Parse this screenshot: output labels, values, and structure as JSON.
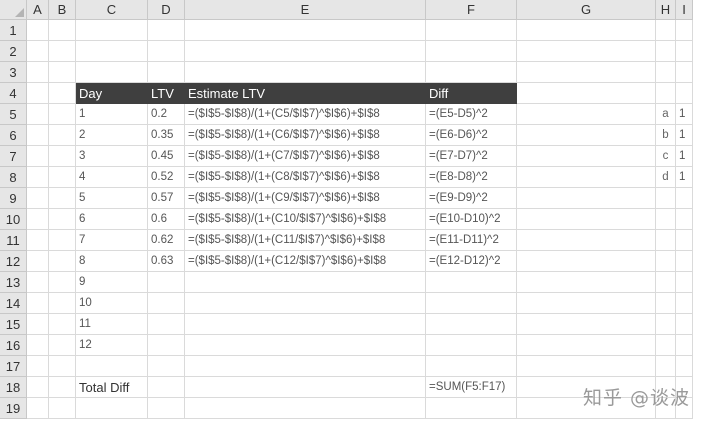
{
  "columns": [
    {
      "key": "A",
      "label": "A"
    },
    {
      "key": "B",
      "label": "B"
    },
    {
      "key": "C",
      "label": "C"
    },
    {
      "key": "D",
      "label": "D"
    },
    {
      "key": "E",
      "label": "E"
    },
    {
      "key": "F",
      "label": "F"
    },
    {
      "key": "G",
      "label": "G"
    },
    {
      "key": "H",
      "label": "H"
    },
    {
      "key": "I",
      "label": "I"
    }
  ],
  "rows": [
    "1",
    "2",
    "3",
    "4",
    "5",
    "6",
    "7",
    "8",
    "9",
    "10",
    "11",
    "12",
    "13",
    "14",
    "15",
    "16",
    "17",
    "18",
    "19"
  ],
  "header": {
    "day": "Day",
    "ltv": "LTV",
    "estimate": "Estimate LTV",
    "diff": "Diff"
  },
  "data_rows": [
    {
      "day": "1",
      "ltv": "0.2",
      "estimate": "=($I$5-$I$8)/(1+(C5/$I$7)^$I$6)+$I$8",
      "diff": "=(E5-D5)^2"
    },
    {
      "day": "2",
      "ltv": "0.35",
      "estimate": "=($I$5-$I$8)/(1+(C6/$I$7)^$I$6)+$I$8",
      "diff": "=(E6-D6)^2"
    },
    {
      "day": "3",
      "ltv": "0.45",
      "estimate": "=($I$5-$I$8)/(1+(C7/$I$7)^$I$6)+$I$8",
      "diff": "=(E7-D7)^2"
    },
    {
      "day": "4",
      "ltv": "0.52",
      "estimate": "=($I$5-$I$8)/(1+(C8/$I$7)^$I$6)+$I$8",
      "diff": "=(E8-D8)^2"
    },
    {
      "day": "5",
      "ltv": "0.57",
      "estimate": "=($I$5-$I$8)/(1+(C9/$I$7)^$I$6)+$I$8",
      "diff": "=(E9-D9)^2"
    },
    {
      "day": "6",
      "ltv": "0.6",
      "estimate": "=($I$5-$I$8)/(1+(C10/$I$7)^$I$6)+$I$8",
      "diff": "=(E10-D10)^2"
    },
    {
      "day": "7",
      "ltv": "0.62",
      "estimate": "=($I$5-$I$8)/(1+(C11/$I$7)^$I$6)+$I$8",
      "diff": "=(E11-D11)^2"
    },
    {
      "day": "8",
      "ltv": "0.63",
      "estimate": "=($I$5-$I$8)/(1+(C12/$I$7)^$I$6)+$I$8",
      "diff": "=(E12-D12)^2"
    }
  ],
  "extra_days": [
    "9",
    "10",
    "11",
    "12"
  ],
  "params": [
    {
      "name": "a",
      "value": "1"
    },
    {
      "name": "b",
      "value": "1"
    },
    {
      "name": "c",
      "value": "1"
    },
    {
      "name": "d",
      "value": "1"
    }
  ],
  "total": {
    "label": "Total Diff",
    "formula": "=SUM(F5:F17)"
  },
  "watermark": "知乎 @谈波"
}
